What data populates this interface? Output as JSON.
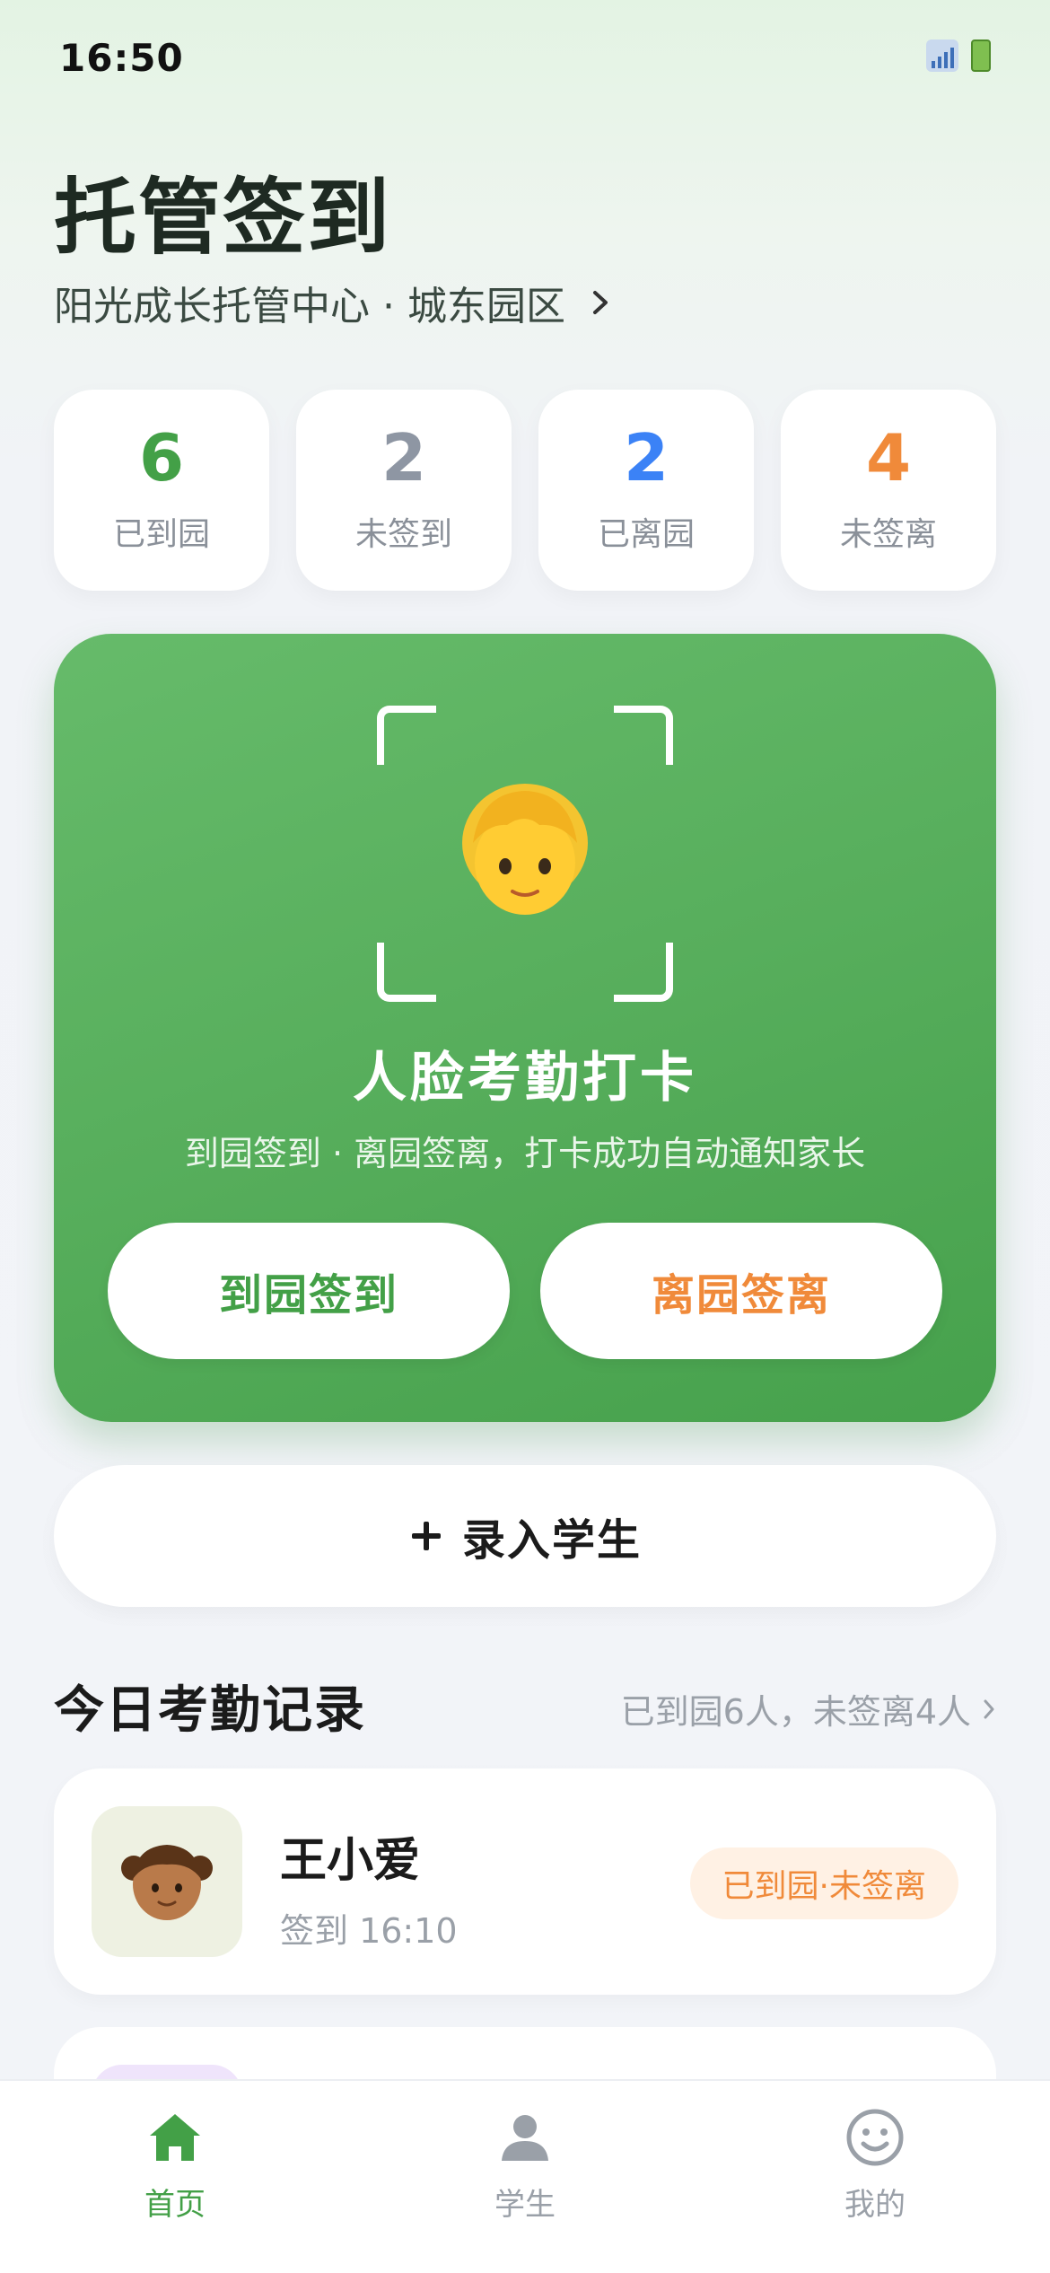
{
  "status_bar": {
    "time": "16:50"
  },
  "header": {
    "title": "托管签到",
    "center_name": "阳光成长托管中心 · 城东园区"
  },
  "stats": [
    {
      "value": "6",
      "label": "已到园",
      "color": "#43a047"
    },
    {
      "value": "2",
      "label": "未签到",
      "color": "#8e96a3"
    },
    {
      "value": "2",
      "label": "已离园",
      "color": "#3b82f6"
    },
    {
      "value": "4",
      "label": "未签离",
      "color": "#f08a3a"
    }
  ],
  "face_card": {
    "title": "人脸考勤打卡",
    "subtitle": "到园签到 · 离园签离，打卡成功自动通知家长",
    "checkin_label": "到园签到",
    "checkout_label": "离园签离",
    "icon": "child-face-icon"
  },
  "add_student": {
    "label": "录入学生"
  },
  "records": {
    "title": "今日考勤记录",
    "summary": "已到园6人，未签离4人",
    "items": [
      {
        "name": "王小爱",
        "time": "签到 16:10",
        "status": "已到园·未签离",
        "avatar_icon": "girl-avatar-icon"
      }
    ]
  },
  "tab_bar": {
    "items": [
      {
        "label": "首页",
        "icon": "home-icon",
        "active": true
      },
      {
        "label": "学生",
        "icon": "person-icon",
        "active": false
      },
      {
        "label": "我的",
        "icon": "smiley-icon",
        "active": false
      }
    ]
  },
  "colors": {
    "primary": "#43a047",
    "accent": "#f08a3a",
    "blue": "#3b82f6",
    "muted": "#9aa0a8"
  }
}
